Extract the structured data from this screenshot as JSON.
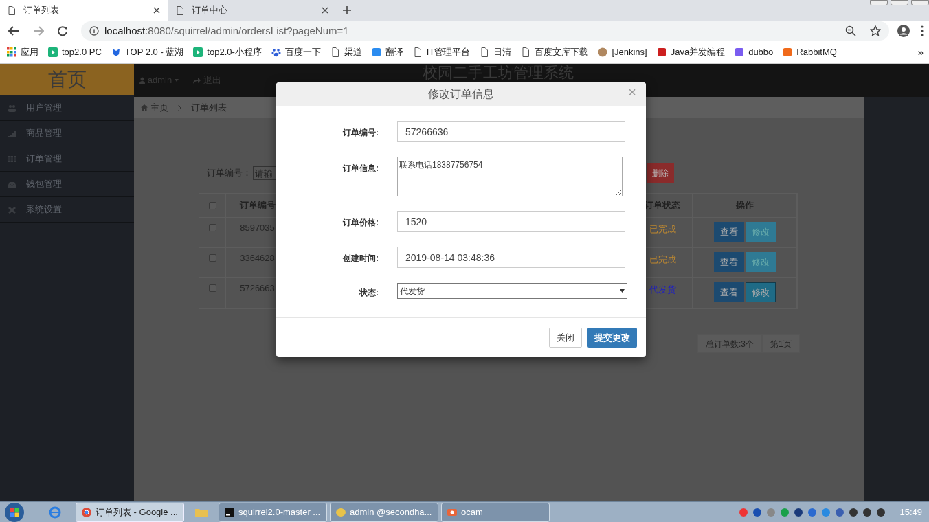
{
  "browser": {
    "tabs": [
      {
        "label": "订单列表",
        "selected": true
      },
      {
        "label": "订单中心",
        "selected": false
      }
    ],
    "address": {
      "host": "localhost",
      "rest": ":8080/squirrel/admin/ordersList?pageNum=1"
    },
    "bookmarks": [
      {
        "label": "应用",
        "kind": "apps"
      },
      {
        "label": "top2.0 PC",
        "kind": "play",
        "color": "#1db47a"
      },
      {
        "label": "TOP 2.0 - 蓝湖",
        "kind": "bird",
        "color": "#2468e0"
      },
      {
        "label": "top2.0-小程序",
        "kind": "play",
        "color": "#1db47a"
      },
      {
        "label": "百度一下",
        "kind": "paw",
        "color": "#2f5fd8"
      },
      {
        "label": "渠道",
        "kind": "page",
        "color": "#555555"
      },
      {
        "label": "翻译",
        "kind": "square",
        "color": "#2b8cf0"
      },
      {
        "label": "IT管理平台",
        "kind": "page",
        "color": "#555555"
      },
      {
        "label": "日清",
        "kind": "page",
        "color": "#555555"
      },
      {
        "label": "百度文库下载",
        "kind": "page",
        "color": "#555555"
      },
      {
        "label": "[Jenkins]",
        "kind": "avatar",
        "color": "#b08860"
      },
      {
        "label": "Java并发编程",
        "kind": "square",
        "color": "#cc1f1f"
      },
      {
        "label": "dubbo",
        "kind": "square",
        "color": "#7a5cf0"
      },
      {
        "label": "RabbitMQ",
        "kind": "square",
        "color": "#f06a1a"
      }
    ],
    "more": "»"
  },
  "app": {
    "logo": "首页",
    "user": "admin",
    "logout": "退出",
    "title": "校园二手工坊管理系统",
    "sidebar": [
      {
        "label": "用户管理"
      },
      {
        "label": "商品管理"
      },
      {
        "label": "订单管理"
      },
      {
        "label": "钱包管理"
      },
      {
        "label": "系统设置"
      }
    ],
    "breadcrumb": [
      "主页",
      "订单列表"
    ],
    "search": {
      "label": "订单编号：",
      "placeholder": "请输"
    },
    "delete_button": "删除",
    "table": {
      "all_checked": false,
      "columns": [
        "订单编号",
        "订单状态",
        "操作"
      ],
      "rows": [
        {
          "checked": false,
          "order_no": "8597035",
          "status": "已完成",
          "color": "#c08a30",
          "actions": [
            "查看",
            "修改"
          ],
          "edit_focused": false
        },
        {
          "checked": false,
          "order_no": "3364628",
          "status": "已完成",
          "color": "#c08a30",
          "actions": [
            "查看",
            "修改"
          ],
          "edit_focused": false
        },
        {
          "checked": false,
          "order_no": "5726663",
          "status": "代发货",
          "color": "#2020c0",
          "actions": [
            "查看",
            "修改"
          ],
          "edit_focused": true
        }
      ]
    },
    "pagination": [
      "总订单数:3个",
      "第1页"
    ]
  },
  "modal": {
    "title": "修改订单信息",
    "close": "×",
    "fields": [
      {
        "label": "订单编号:",
        "kind": "input",
        "value": "57266636"
      },
      {
        "label": "订单信息:",
        "kind": "textarea",
        "value": "联系电话18387756754"
      },
      {
        "label": "订单价格:",
        "kind": "input",
        "value": "1520"
      },
      {
        "label": "创建时间:",
        "kind": "input",
        "value": "2019-08-14 03:48:36"
      },
      {
        "label": "状态:",
        "kind": "select",
        "value": "代发货"
      }
    ],
    "buttons": [
      {
        "label": "关闭",
        "primary": false
      },
      {
        "label": "提交更改",
        "primary": true
      }
    ]
  },
  "taskbar": {
    "items": [
      {
        "label": "订单列表 - Google ...",
        "selected": true
      },
      {
        "label": "squirrel2.0-master ...",
        "selected": false
      },
      {
        "label": "admin @secondha...",
        "selected": false
      },
      {
        "label": "ocam",
        "selected": false
      }
    ],
    "time": "15:49"
  }
}
